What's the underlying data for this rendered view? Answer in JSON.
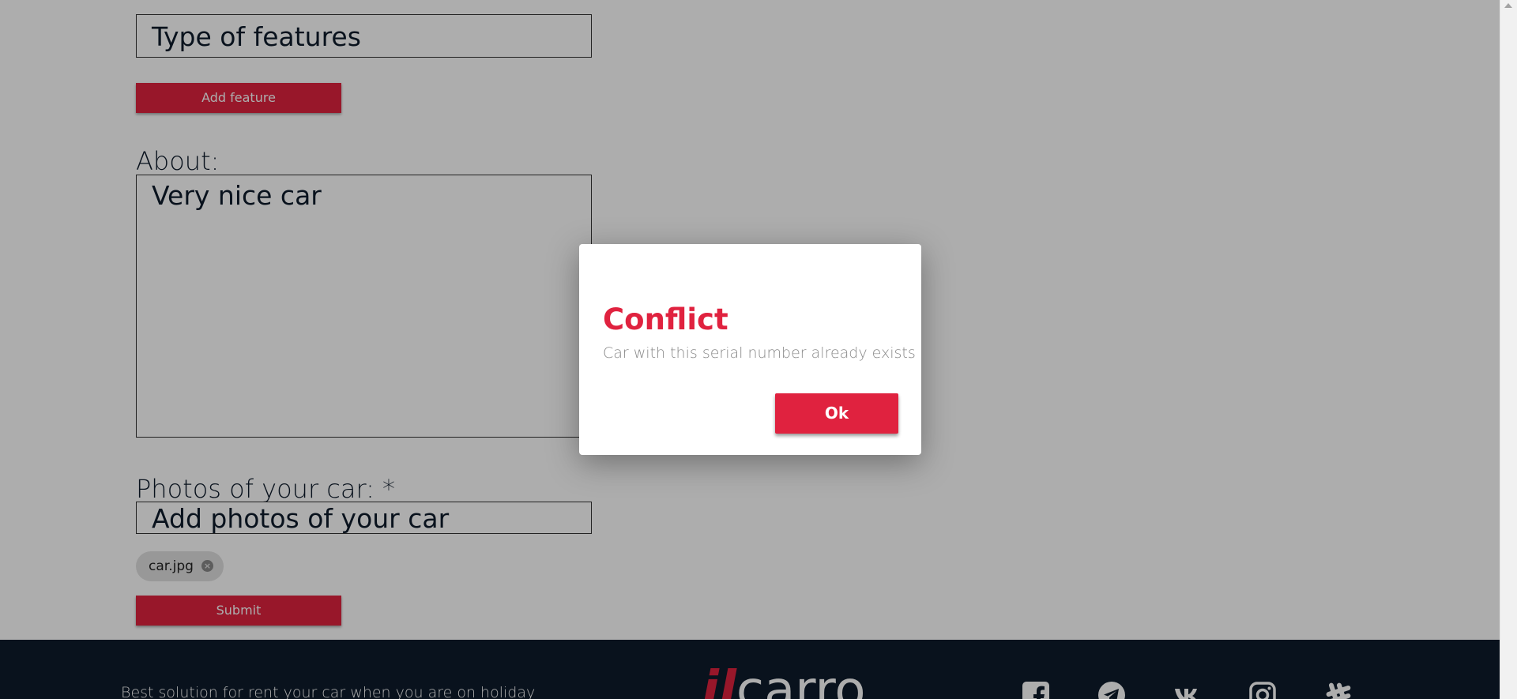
{
  "form": {
    "features_placeholder": "Type of features",
    "add_feature_label": "Add feature",
    "about_label": "About:",
    "about_value": "Very nice car",
    "photos_label": "Photos of your car: *",
    "photos_placeholder": "Add photos of your car",
    "photo_chip": "car.jpg",
    "submit_label": "Submit"
  },
  "footer": {
    "tagline": "Best solution for rent your car when you are on holiday",
    "logo_prefix": "il",
    "logo_main": "carro",
    "social_icons": [
      "facebook-icon",
      "telegram-icon",
      "vk-icon",
      "instagram-icon",
      "slack-icon"
    ]
  },
  "dialog": {
    "title": "Conflict",
    "message": "Car with this serial number already exists",
    "ok_label": "Ok"
  },
  "colors": {
    "accent": "#e0223f",
    "footer_bg": "#0e1b2b",
    "overlay": "rgba(0,0,0,0.32)"
  }
}
